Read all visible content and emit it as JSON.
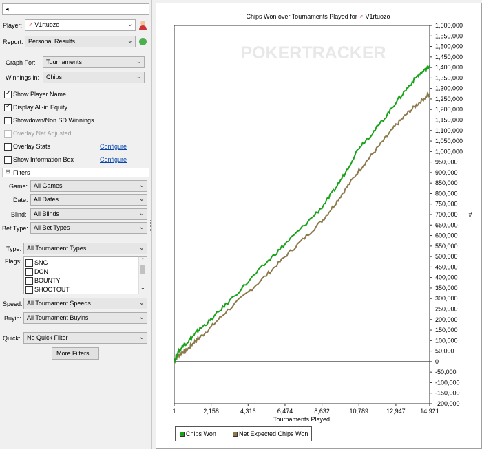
{
  "top_combo": {
    "arrow": "◂"
  },
  "player": {
    "label": "Player:",
    "value": "V1rtuozo"
  },
  "report": {
    "label": "Report:",
    "value": "Personal Results"
  },
  "graph_for": {
    "label": "Graph For:",
    "value": "Tournaments"
  },
  "winnings_in": {
    "label": "Winnings in:",
    "value": "Chips"
  },
  "options": {
    "show_player_name": "Show Player Name",
    "display_allin": "Display All-in Equity",
    "showdown": "Showdown/Non SD Winnings",
    "overlay_net": "Overlay Net Adjusted",
    "overlay_stats": "Overlay Stats",
    "show_info_box": "Show Information Box",
    "configure": "Configure"
  },
  "filters": {
    "header": "Filters",
    "game": {
      "label": "Game:",
      "value": "All Games"
    },
    "date": {
      "label": "Date:",
      "value": "All Dates"
    },
    "blind": {
      "label": "Blind:",
      "value": "All Blinds"
    },
    "bet_type": {
      "label": "Bet Type:",
      "value": "All Bet Types"
    },
    "type": {
      "label": "Type:",
      "value": "All Tournament Types"
    },
    "flags_label": "Flags:",
    "flags": [
      "SNG",
      "DON",
      "BOUNTY",
      "SHOOTOUT"
    ],
    "speed": {
      "label": "Speed:",
      "value": "All Tournament Speeds"
    },
    "buyin": {
      "label": "Buyin:",
      "value": "All Tournament Buyins"
    },
    "quick": {
      "label": "Quick:",
      "value": "No Quick Filter"
    },
    "more_filters": "More Filters..."
  },
  "chart_data": {
    "type": "line",
    "title": "Chips Won over Tournaments Played for",
    "player_name": "V1rtuozo",
    "watermark": "POKERTRACKER",
    "xlabel": "Tournaments Played",
    "ylabel": "#",
    "x_ticks": [
      "1",
      "2,158",
      "4,316",
      "6,474",
      "8,632",
      "10,789",
      "12,947",
      "14,921"
    ],
    "x_tick_values": [
      1,
      2158,
      4316,
      6474,
      8632,
      10789,
      12947,
      14921
    ],
    "xlim": [
      1,
      14921
    ],
    "ylim": [
      -200000,
      1600000
    ],
    "y_step": 50000,
    "grid": false,
    "legend_placement": "bottom-left",
    "series": [
      {
        "name": "Chips Won",
        "color": "#1aa31a",
        "x": [
          1,
          200,
          500,
          800,
          1200,
          1500,
          2158,
          3000,
          4316,
          5500,
          6474,
          7500,
          8632,
          9300,
          10000,
          10789,
          11500,
          12300,
          12947,
          13600,
          14200,
          14700,
          14921
        ],
        "y": [
          0,
          40000,
          75000,
          95000,
          130000,
          155000,
          200000,
          270000,
          380000,
          480000,
          560000,
          640000,
          735000,
          810000,
          900000,
          1020000,
          1080000,
          1160000,
          1235000,
          1300000,
          1360000,
          1390000,
          1410000
        ]
      },
      {
        "name": "Net Expected Chips Won",
        "color": "#8c7a4e",
        "x": [
          1,
          200,
          500,
          800,
          1200,
          1500,
          2158,
          3000,
          4316,
          5500,
          6474,
          7500,
          8632,
          9300,
          10000,
          10789,
          11500,
          12300,
          12947,
          13600,
          14200,
          14700,
          14921
        ],
        "y": [
          0,
          25000,
          45000,
          60000,
          95000,
          115000,
          165000,
          235000,
          330000,
          420000,
          500000,
          580000,
          670000,
          740000,
          820000,
          910000,
          980000,
          1060000,
          1125000,
          1180000,
          1225000,
          1260000,
          1275000
        ]
      }
    ]
  }
}
